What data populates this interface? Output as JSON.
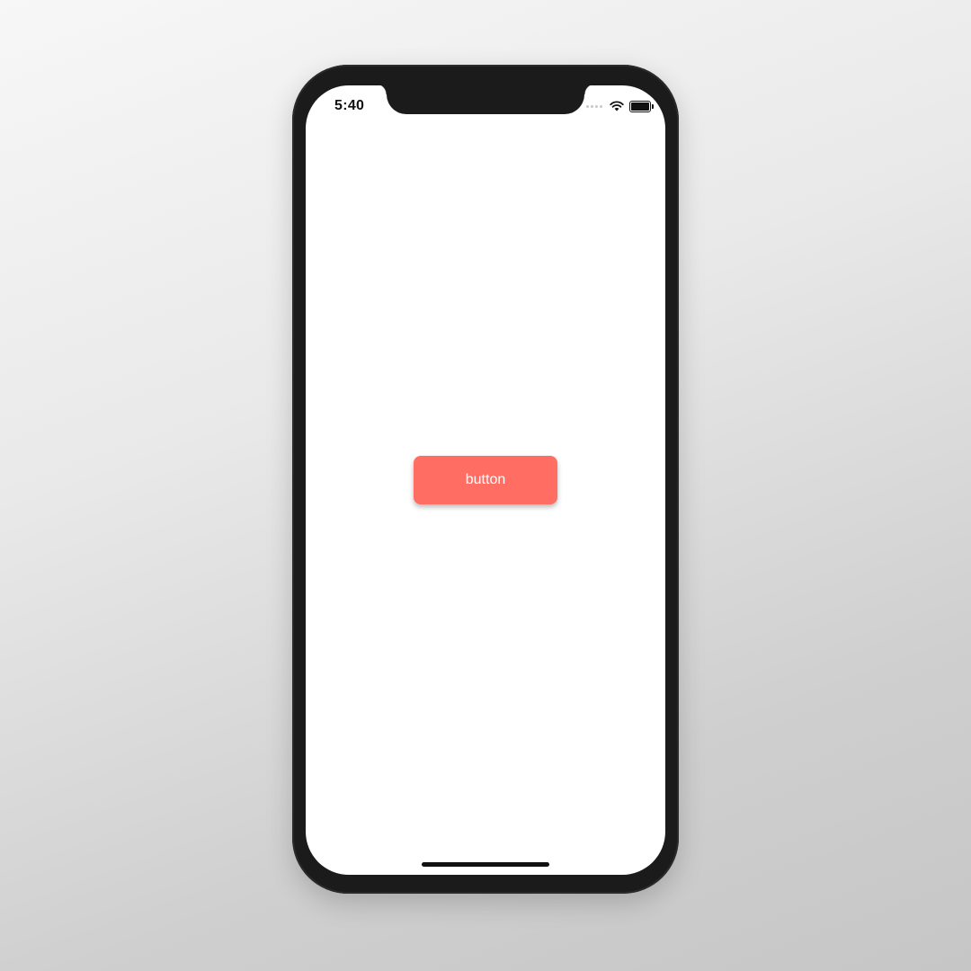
{
  "status_bar": {
    "time": "5:40",
    "icons": [
      "signal-dots-icon",
      "wifi-icon",
      "battery-icon"
    ]
  },
  "main": {
    "button_label": "button",
    "button_color": "#ff6d63"
  },
  "colors": {
    "frame": "#1b1b1b",
    "screen": "#ffffff",
    "background_top": "#f7f7f7",
    "background_bottom": "#c6c6c6"
  }
}
